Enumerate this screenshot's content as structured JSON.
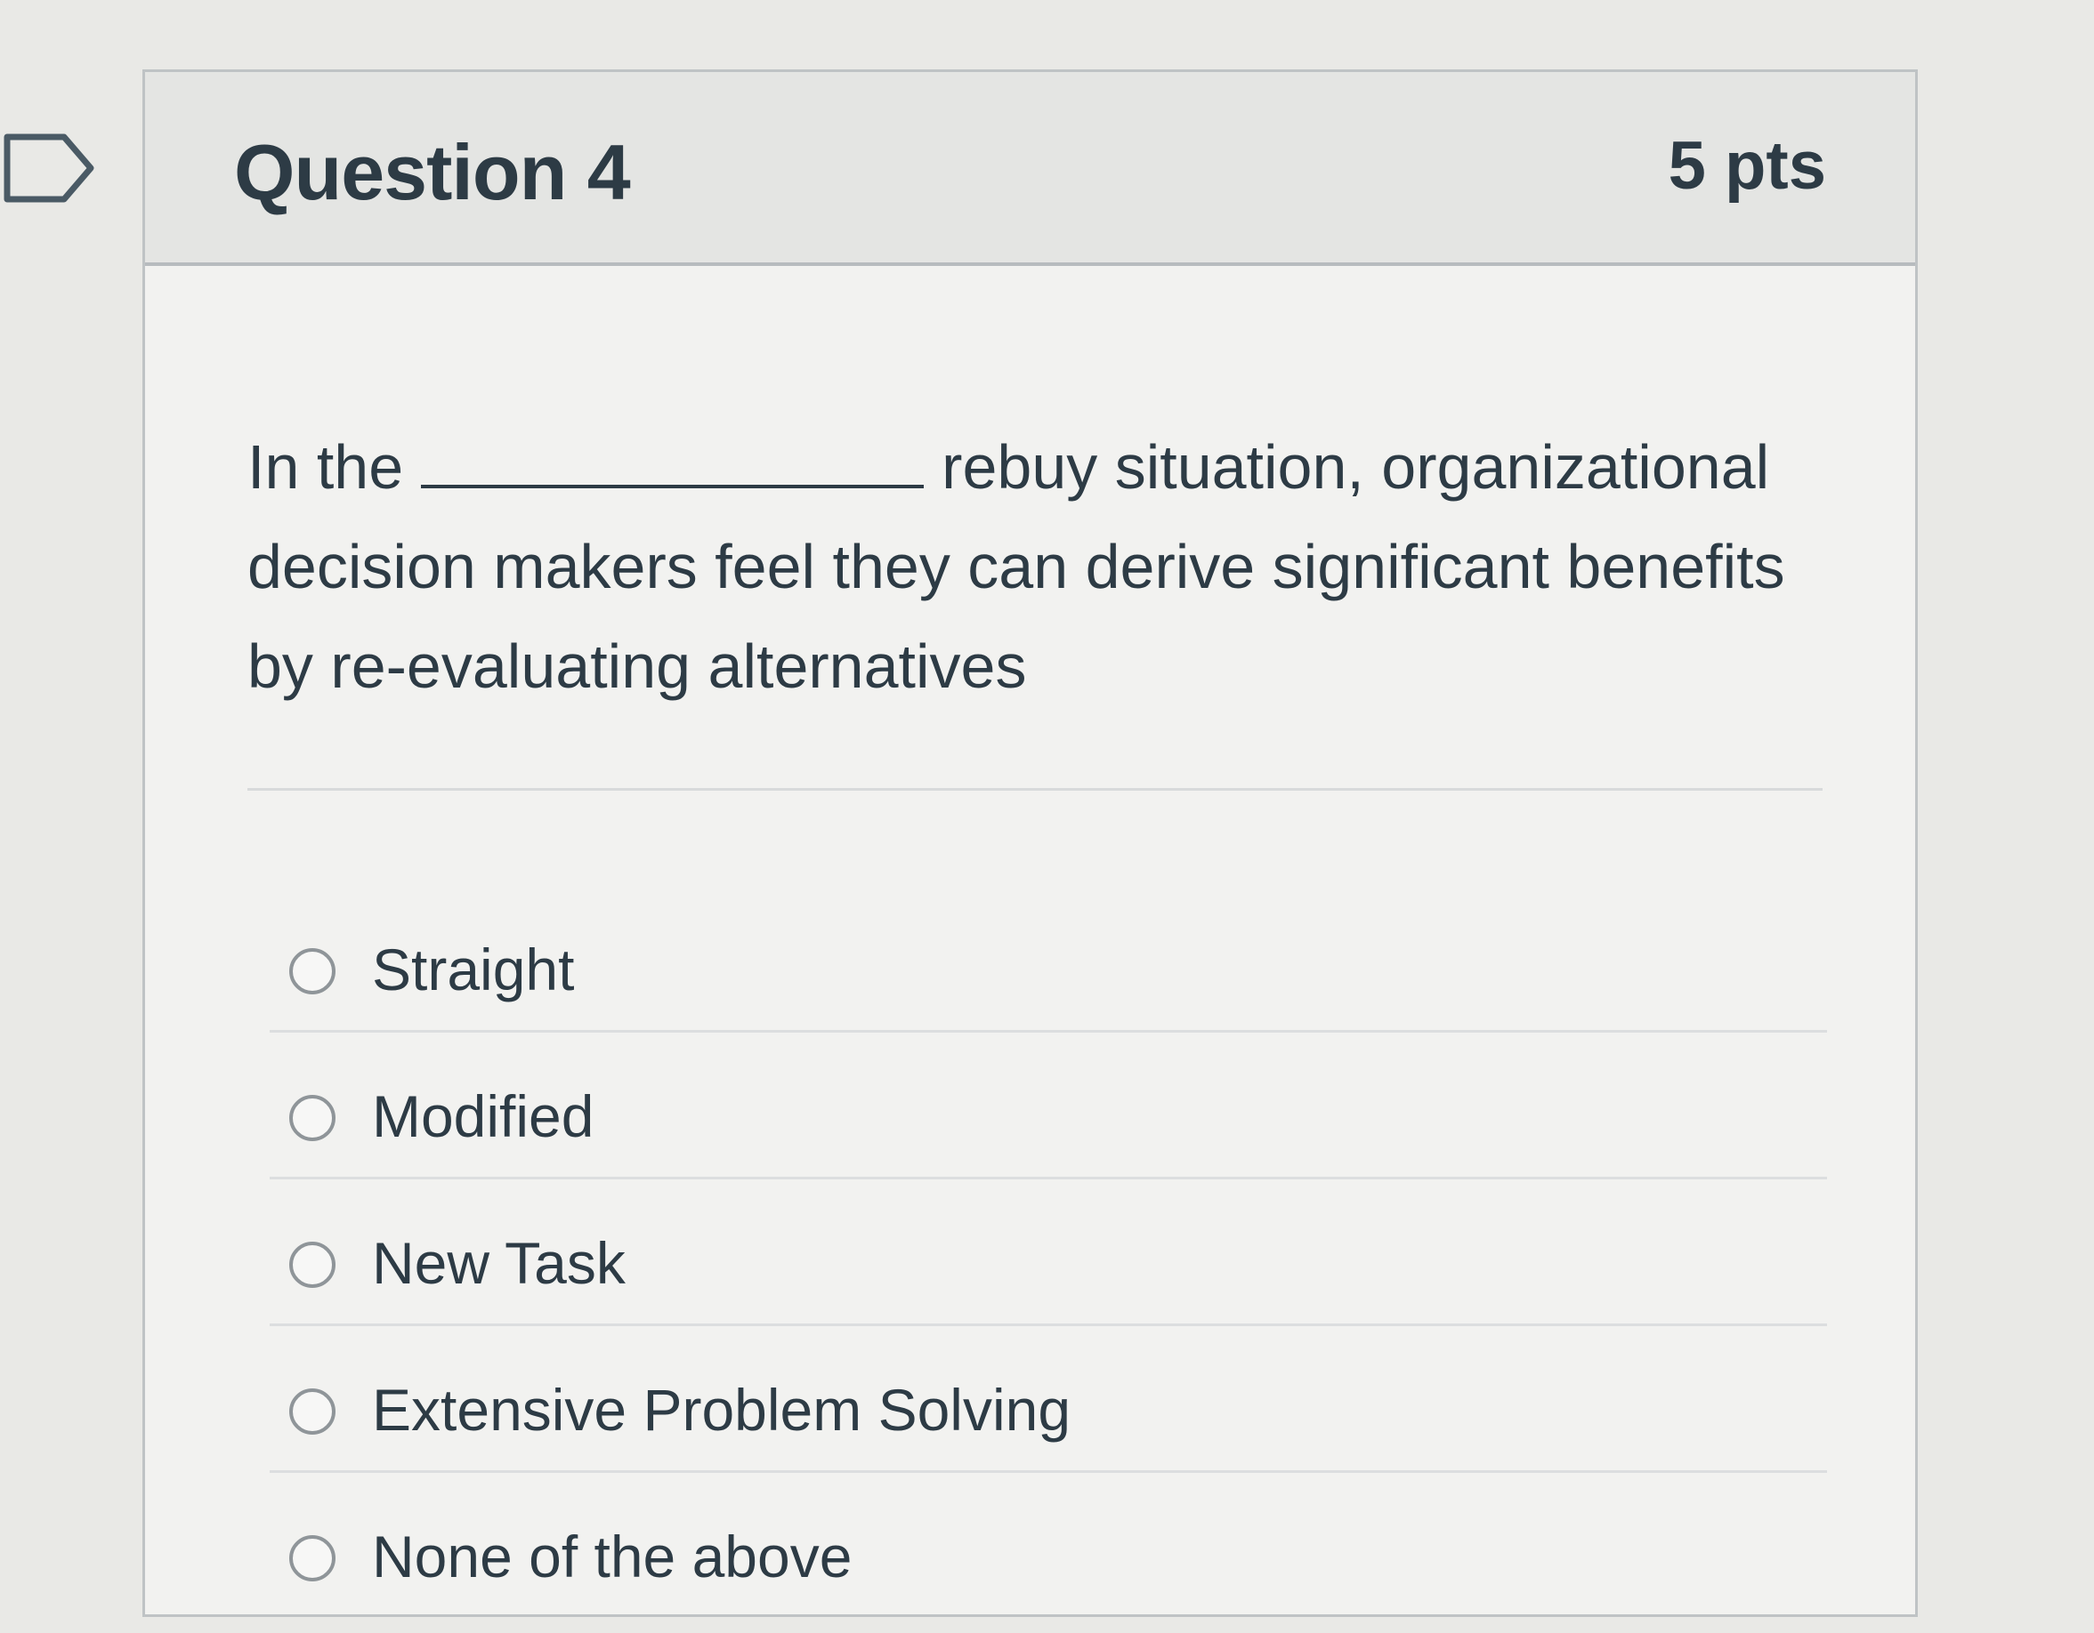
{
  "question": {
    "title": "Question 4",
    "points": "5 pts",
    "text_before": "In the",
    "text_after": "rebuy situation, organizational decision makers feel they can derive significant benefits by re-evaluating alternatives"
  },
  "answers": [
    {
      "label": "Straight"
    },
    {
      "label": "Modified"
    },
    {
      "label": "New Task"
    },
    {
      "label": "Extensive Problem Solving"
    },
    {
      "label": "None of the above"
    }
  ],
  "colors": {
    "text": "#2d3b45",
    "header_bg": "#e4e5e3",
    "card_bg": "#f2f2f0",
    "border": "#bfc3c5"
  },
  "icons": {
    "flag": "flag-outline-icon",
    "radio": "radio-unchecked-icon"
  }
}
